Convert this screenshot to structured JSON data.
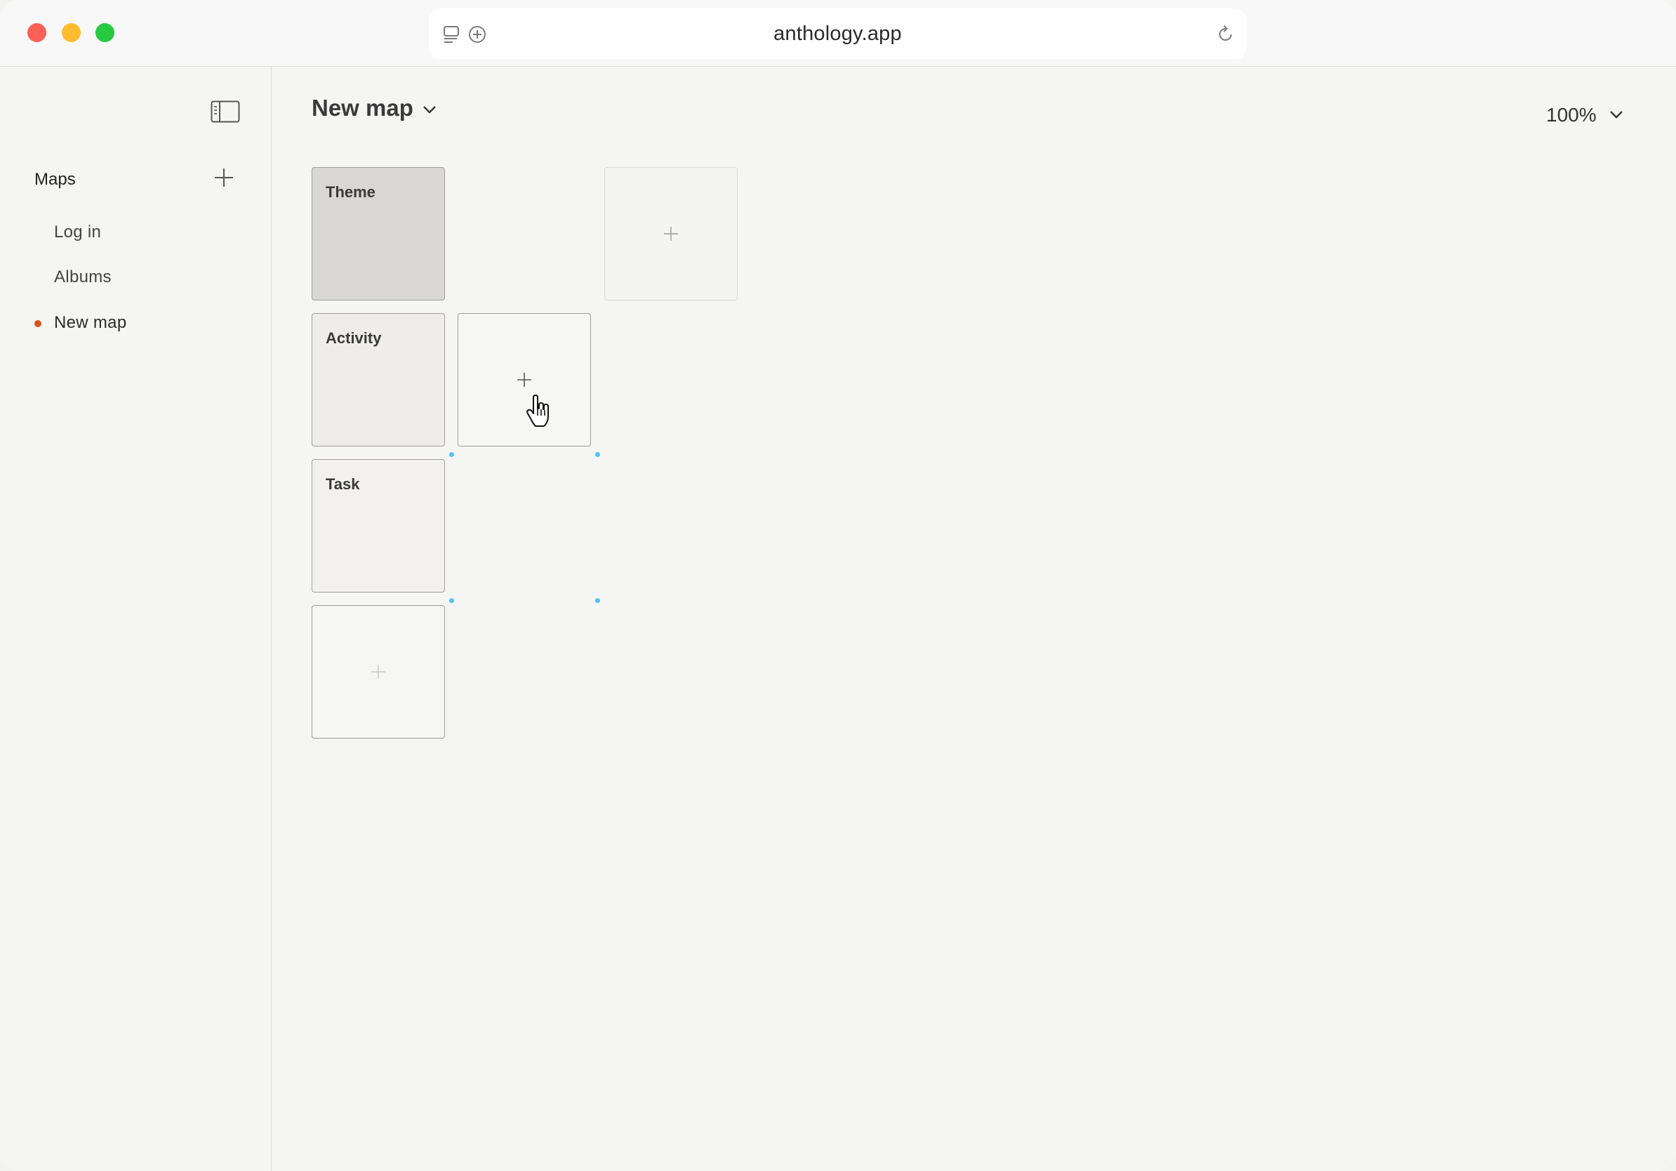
{
  "browser": {
    "url": "anthology.app"
  },
  "sidebar": {
    "section_title": "Maps",
    "items": [
      {
        "label": "Log in",
        "active": false
      },
      {
        "label": "Albums",
        "active": false
      },
      {
        "label": "New map",
        "active": true
      }
    ],
    "active_dot_color": "#d2561a"
  },
  "main": {
    "title": "New map",
    "zoom": "100%",
    "cards": [
      {
        "label": "Theme"
      },
      {
        "label": "Activity"
      },
      {
        "label": "Task"
      }
    ]
  },
  "icons": {
    "sidebar_toggle": "sidebar-icon",
    "add": "plus-icon",
    "reload": "reload-icon",
    "cursor": "hand-pointer-icon"
  },
  "colors": {
    "accent_handle": "#4fc3f7"
  }
}
